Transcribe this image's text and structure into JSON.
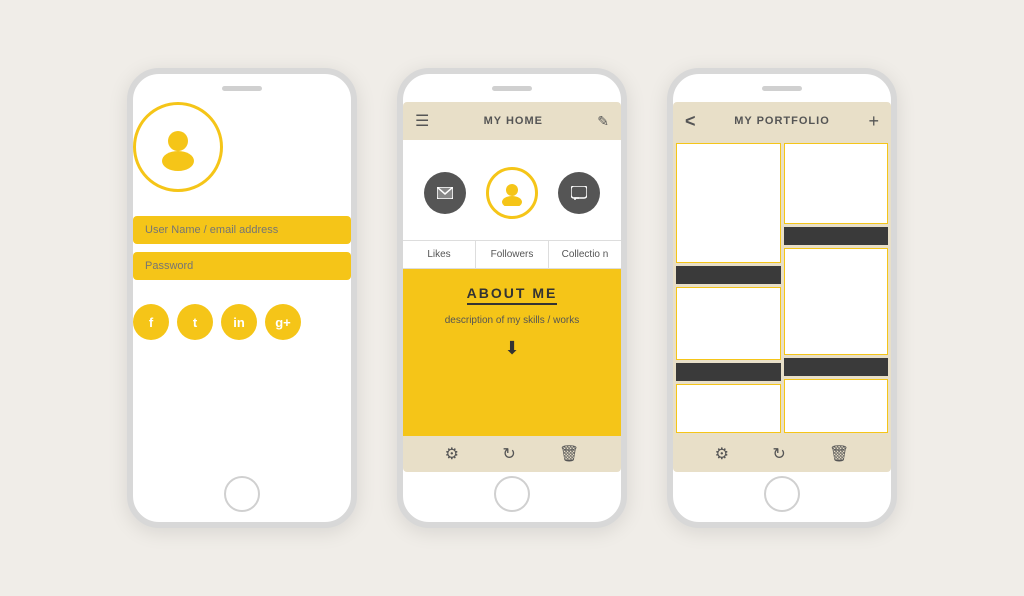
{
  "phone1": {
    "avatar_placeholder": "👤",
    "username_placeholder": "User Name / email address",
    "password_placeholder": "Password",
    "social": [
      "f",
      "t",
      "in",
      "g+"
    ]
  },
  "phone2": {
    "header": {
      "title": "MY HOME",
      "menu_icon": "☰",
      "edit_icon": "✎"
    },
    "tabs": [
      "Likes",
      "Followers",
      "Collection"
    ],
    "about": {
      "title": "ABOUT ME",
      "description": "description of my skills / works"
    },
    "footer_icons": [
      "⚙",
      "↻",
      "🗑"
    ]
  },
  "phone3": {
    "header": {
      "title": "MY PORTFOLIO",
      "back_icon": "<",
      "add_icon": "+"
    },
    "footer_icons": [
      "⚙",
      "↻",
      "🗑"
    ]
  }
}
